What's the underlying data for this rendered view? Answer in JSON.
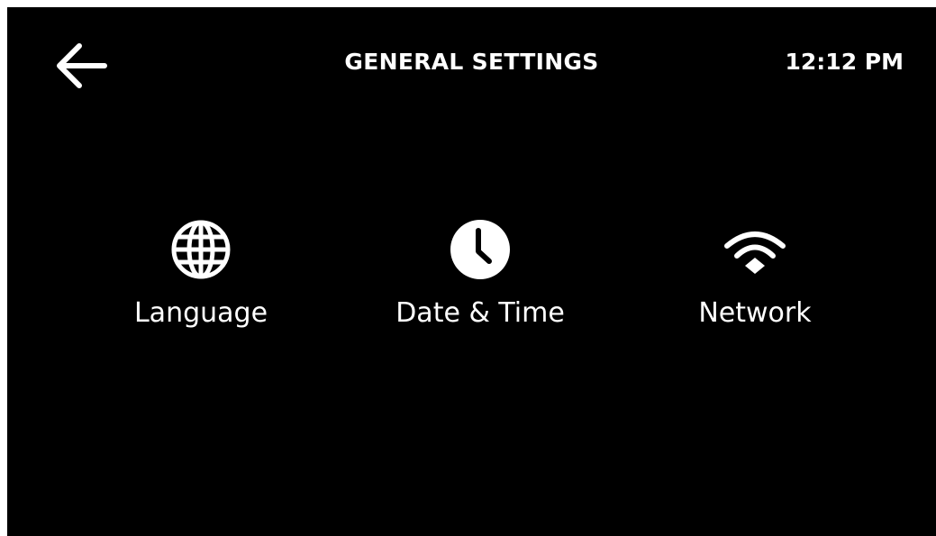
{
  "header": {
    "title": "GENERAL SETTINGS",
    "time": "12:12 PM",
    "back_icon": "arrow-left-icon"
  },
  "colors": {
    "background": "#000000",
    "foreground": "#ffffff"
  },
  "settings": [
    {
      "label": "Language",
      "icon": "globe-icon"
    },
    {
      "label": "Date & Time",
      "icon": "clock-icon"
    },
    {
      "label": "Network",
      "icon": "wifi-icon"
    }
  ]
}
